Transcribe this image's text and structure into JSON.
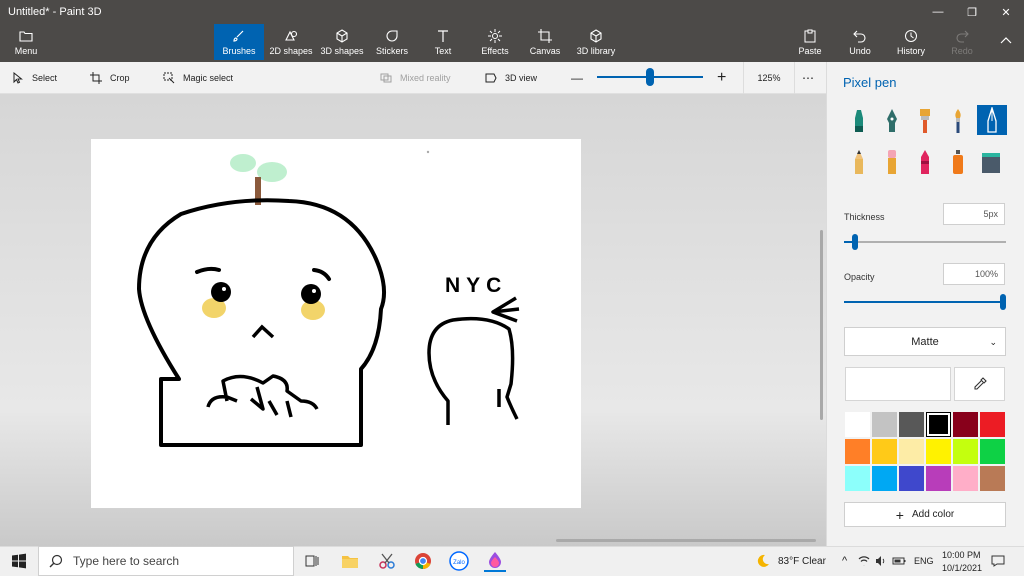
{
  "window": {
    "title": "Untitled* - Paint 3D",
    "controls": [
      "minimize",
      "maximize",
      "close"
    ]
  },
  "ribbon": {
    "menu": "Menu",
    "items": [
      {
        "label": "Brushes",
        "icon": "brush-icon",
        "active": true
      },
      {
        "label": "2D shapes",
        "icon": "2d-shapes-icon"
      },
      {
        "label": "3D shapes",
        "icon": "3d-shapes-icon"
      },
      {
        "label": "Stickers",
        "icon": "stickers-icon"
      },
      {
        "label": "Text",
        "icon": "text-icon"
      },
      {
        "label": "Effects",
        "icon": "effects-icon"
      },
      {
        "label": "Canvas",
        "icon": "canvas-icon"
      },
      {
        "label": "3D library",
        "icon": "3d-library-icon"
      }
    ],
    "right": [
      {
        "label": "Paste",
        "icon": "paste-icon"
      },
      {
        "label": "Undo",
        "icon": "undo-icon"
      },
      {
        "label": "History",
        "icon": "history-icon"
      },
      {
        "label": "Redo",
        "icon": "redo-icon",
        "disabled": true
      }
    ]
  },
  "toolbar": {
    "select": "Select",
    "crop": "Crop",
    "magic_select": "Magic select",
    "mixed_reality": "Mixed reality",
    "view_3d": "3D view",
    "zoom_minus": "—",
    "zoom_plus": "+",
    "zoom_level": "125%",
    "zoom_fraction": 0.5,
    "more": "⋯"
  },
  "panel": {
    "title": "Pixel pen",
    "brushes": [
      "marker",
      "calligraphy-pen",
      "oil-brush",
      "watercolor",
      "pixel-pen",
      "pencil",
      "eraser",
      "crayon",
      "spray-can",
      "fill"
    ],
    "selected_brush": "pixel-pen",
    "thickness_label": "Thickness",
    "thickness_value": "5px",
    "thickness_fraction": 0.05,
    "opacity_label": "Opacity",
    "opacity_value": "100%",
    "opacity_fraction": 1.0,
    "finish": "Matte",
    "add_color": "Add color",
    "palette": [
      "#ffffff",
      "#c3c3c3",
      "#585858",
      "#000000",
      "#88001b",
      "#ec1c24",
      "#ff7f27",
      "#ffca18",
      "#fdeca6",
      "#fff200",
      "#c4ff0e",
      "#0ed145",
      "#8cfffb",
      "#00a8f3",
      "#3f48cc",
      "#b83dba",
      "#ffaec8",
      "#b97a56"
    ],
    "selected_color": "#000000"
  },
  "canvas": {
    "drawing_text": "NYC"
  },
  "taskbar": {
    "search_placeholder": "Type here to search",
    "weather": "83°F  Clear",
    "language": "ENG",
    "time": "10:00 PM",
    "date": "10/1/2021",
    "zalo": "Zalo"
  },
  "colors": {
    "accent": "#0063b1",
    "titlebar": "#4c4a48"
  }
}
